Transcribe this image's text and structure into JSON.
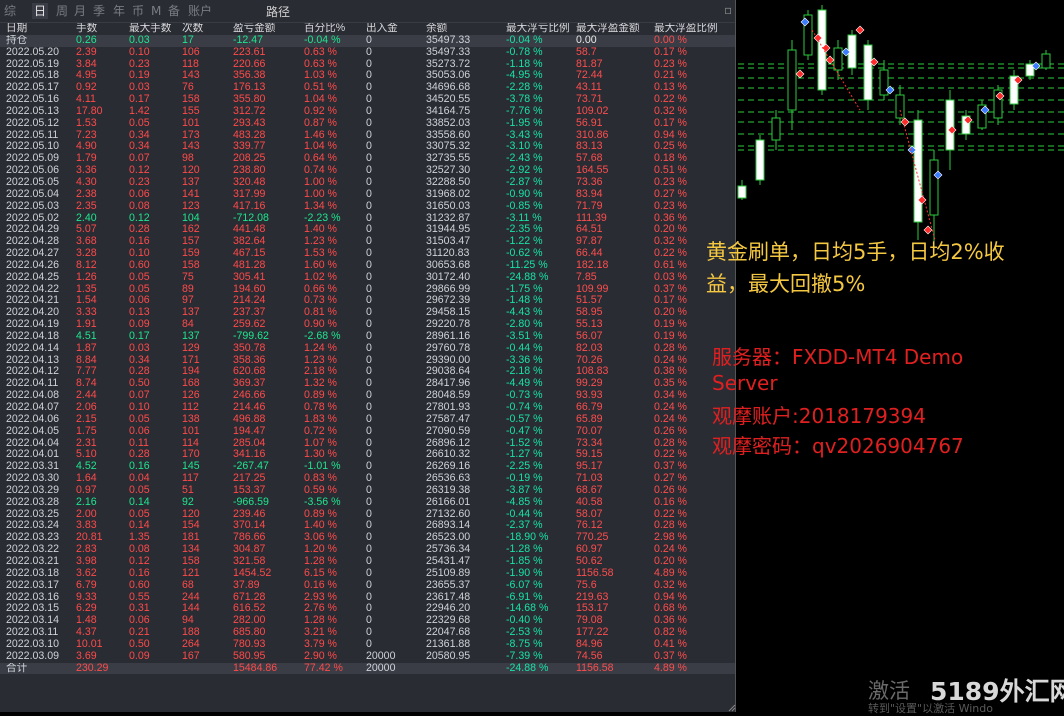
{
  "toolbar": {
    "tabs": [
      "综",
      "日",
      "周",
      "月",
      "季",
      "年",
      "币",
      "M",
      "备",
      "账户"
    ],
    "active_tab": "日",
    "right_label": "路径",
    "close_glyph": "▫"
  },
  "table": {
    "headers": [
      "日期",
      "手数",
      "最大手数",
      "次数",
      "盈亏金额",
      "百分比%",
      "出入金",
      "余额",
      "最大浮亏比例",
      "最大浮盈金额",
      "最大浮盈比例"
    ],
    "holding": {
      "label": "持仓",
      "lots": "0.26",
      "max_lots": "0.03",
      "count": "17",
      "pnl": "-12.47",
      "pct": "-0.04 %",
      "flow": "0",
      "balance": "35497.33",
      "max_dd": "-0.04 %",
      "max_fp": "0.00",
      "max_fp_pct": "0.00 %"
    },
    "rows": [
      [
        "2022.05.20",
        "2.39",
        "0.10",
        "106",
        "223.61",
        "0.63 %",
        "0",
        "35497.33",
        "-0.78 %",
        "58.7",
        "0.17 %"
      ],
      [
        "2022.05.19",
        "3.84",
        "0.23",
        "118",
        "220.66",
        "0.63 %",
        "0",
        "35273.72",
        "-1.18 %",
        "81.87",
        "0.23 %"
      ],
      [
        "2022.05.18",
        "4.95",
        "0.19",
        "143",
        "356.38",
        "1.03 %",
        "0",
        "35053.06",
        "-4.95 %",
        "72.44",
        "0.21 %"
      ],
      [
        "2022.05.17",
        "0.92",
        "0.03",
        "76",
        "176.13",
        "0.51 %",
        "0",
        "34696.68",
        "-2.28 %",
        "43.11",
        "0.13 %"
      ],
      [
        "2022.05.16",
        "4.11",
        "0.17",
        "158",
        "355.80",
        "1.04 %",
        "0",
        "34520.55",
        "-3.78 %",
        "73.71",
        "0.22 %"
      ],
      [
        "2022.05.13",
        "17.80",
        "1.42",
        "155",
        "312.72",
        "0.92 %",
        "0",
        "34164.75",
        "-7.76 %",
        "109.02",
        "0.32 %"
      ],
      [
        "2022.05.12",
        "1.53",
        "0.05",
        "101",
        "293.43",
        "0.87 %",
        "0",
        "33852.03",
        "-1.95 %",
        "56.91",
        "0.17 %"
      ],
      [
        "2022.05.11",
        "7.23",
        "0.34",
        "173",
        "483.28",
        "1.46 %",
        "0",
        "33558.60",
        "-3.43 %",
        "310.86",
        "0.94 %"
      ],
      [
        "2022.05.10",
        "4.90",
        "0.34",
        "143",
        "339.77",
        "1.04 %",
        "0",
        "33075.32",
        "-3.10 %",
        "83.13",
        "0.25 %"
      ],
      [
        "2022.05.09",
        "1.79",
        "0.07",
        "98",
        "208.25",
        "0.64 %",
        "0",
        "32735.55",
        "-2.43 %",
        "57.68",
        "0.18 %"
      ],
      [
        "2022.05.06",
        "3.36",
        "0.12",
        "120",
        "238.80",
        "0.74 %",
        "0",
        "32527.30",
        "-2.92 %",
        "164.55",
        "0.51 %"
      ],
      [
        "2022.05.05",
        "4.30",
        "0.23",
        "137",
        "320.48",
        "1.00 %",
        "0",
        "32288.50",
        "-2.87 %",
        "73.36",
        "0.23 %"
      ],
      [
        "2022.05.04",
        "2.38",
        "0.06",
        "141",
        "317.99",
        "1.00 %",
        "0",
        "31968.02",
        "-0.90 %",
        "83.94",
        "0.27 %"
      ],
      [
        "2022.05.03",
        "2.35",
        "0.08",
        "123",
        "417.16",
        "1.34 %",
        "0",
        "31650.03",
        "-0.85 %",
        "71.79",
        "0.23 %"
      ],
      [
        "2022.05.02",
        "2.40",
        "0.12",
        "104",
        "-712.08",
        "-2.23 %",
        "0",
        "31232.87",
        "-3.11 %",
        "111.39",
        "0.36 %"
      ],
      [
        "2022.04.29",
        "5.07",
        "0.28",
        "162",
        "441.48",
        "1.40 %",
        "0",
        "31944.95",
        "-2.35 %",
        "64.51",
        "0.20 %"
      ],
      [
        "2022.04.28",
        "3.68",
        "0.16",
        "157",
        "382.64",
        "1.23 %",
        "0",
        "31503.47",
        "-1.22 %",
        "97.87",
        "0.32 %"
      ],
      [
        "2022.04.27",
        "3.28",
        "0.10",
        "159",
        "467.15",
        "1.53 %",
        "0",
        "31120.83",
        "-0.62 %",
        "66.44",
        "0.22 %"
      ],
      [
        "2022.04.26",
        "8.12",
        "0.60",
        "158",
        "481.28",
        "1.60 %",
        "0",
        "30653.68",
        "-11.25 %",
        "182.18",
        "0.61 %"
      ],
      [
        "2022.04.25",
        "1.26",
        "0.05",
        "75",
        "305.41",
        "1.02 %",
        "0",
        "30172.40",
        "-24.88 %",
        "7.85",
        "0.03 %"
      ],
      [
        "2022.04.22",
        "1.35",
        "0.05",
        "89",
        "194.60",
        "0.66 %",
        "0",
        "29866.99",
        "-1.75 %",
        "109.99",
        "0.37 %"
      ],
      [
        "2022.04.21",
        "1.54",
        "0.06",
        "97",
        "214.24",
        "0.73 %",
        "0",
        "29672.39",
        "-1.48 %",
        "51.57",
        "0.17 %"
      ],
      [
        "2022.04.20",
        "3.33",
        "0.13",
        "137",
        "237.37",
        "0.81 %",
        "0",
        "29458.15",
        "-4.43 %",
        "58.95",
        "0.20 %"
      ],
      [
        "2022.04.19",
        "1.91",
        "0.09",
        "84",
        "259.62",
        "0.90 %",
        "0",
        "29220.78",
        "-2.80 %",
        "55.13",
        "0.19 %"
      ],
      [
        "2022.04.18",
        "4.51",
        "0.17",
        "137",
        "-799.62",
        "-2.68 %",
        "0",
        "28961.16",
        "-3.51 %",
        "56.07",
        "0.19 %"
      ],
      [
        "2022.04.14",
        "1.87",
        "0.03",
        "129",
        "350.78",
        "1.24 %",
        "0",
        "29760.78",
        "-0.44 %",
        "82.03",
        "0.28 %"
      ],
      [
        "2022.04.13",
        "8.84",
        "0.34",
        "171",
        "358.36",
        "1.23 %",
        "0",
        "29390.00",
        "-3.36 %",
        "70.26",
        "0.24 %"
      ],
      [
        "2022.04.12",
        "7.77",
        "0.28",
        "194",
        "620.68",
        "2.18 %",
        "0",
        "29038.64",
        "-2.18 %",
        "108.83",
        "0.38 %"
      ],
      [
        "2022.04.11",
        "8.74",
        "0.50",
        "168",
        "369.37",
        "1.32 %",
        "0",
        "28417.96",
        "-4.49 %",
        "99.29",
        "0.35 %"
      ],
      [
        "2022.04.08",
        "2.44",
        "0.07",
        "126",
        "246.66",
        "0.89 %",
        "0",
        "28048.59",
        "-0.73 %",
        "93.93",
        "0.34 %"
      ],
      [
        "2022.04.07",
        "2.06",
        "0.10",
        "112",
        "214.46",
        "0.78 %",
        "0",
        "27801.93",
        "-0.74 %",
        "66.79",
        "0.24 %"
      ],
      [
        "2022.04.06",
        "2.15",
        "0.05",
        "138",
        "496.88",
        "1.83 %",
        "0",
        "27587.47",
        "-0.57 %",
        "65.89",
        "0.24 %"
      ],
      [
        "2022.04.05",
        "1.75",
        "0.06",
        "101",
        "194.47",
        "0.72 %",
        "0",
        "27090.59",
        "-0.47 %",
        "70.07",
        "0.26 %"
      ],
      [
        "2022.04.04",
        "2.31",
        "0.11",
        "114",
        "285.04",
        "1.07 %",
        "0",
        "26896.12",
        "-1.52 %",
        "73.34",
        "0.28 %"
      ],
      [
        "2022.04.01",
        "5.10",
        "0.28",
        "170",
        "341.16",
        "1.30 %",
        "0",
        "26610.32",
        "-1.27 %",
        "59.15",
        "0.22 %"
      ],
      [
        "2022.03.31",
        "4.52",
        "0.16",
        "145",
        "-267.47",
        "-1.01 %",
        "0",
        "26269.16",
        "-2.25 %",
        "95.17",
        "0.37 %"
      ],
      [
        "2022.03.30",
        "1.64",
        "0.04",
        "117",
        "217.25",
        "0.83 %",
        "0",
        "26536.63",
        "-0.19 %",
        "71.03",
        "0.27 %"
      ],
      [
        "2022.03.29",
        "0.97",
        "0.05",
        "51",
        "153.37",
        "0.59 %",
        "0",
        "26319.38",
        "-3.87 %",
        "68.67",
        "0.26 %"
      ],
      [
        "2022.03.28",
        "2.16",
        "0.14",
        "92",
        "-966.59",
        "-3.56 %",
        "0",
        "26166.01",
        "-4.85 %",
        "40.58",
        "0.16 %"
      ],
      [
        "2022.03.25",
        "2.00",
        "0.05",
        "120",
        "239.46",
        "0.89 %",
        "0",
        "27132.60",
        "-0.44 %",
        "58.07",
        "0.22 %"
      ],
      [
        "2022.03.24",
        "3.83",
        "0.14",
        "154",
        "370.14",
        "1.40 %",
        "0",
        "26893.14",
        "-2.37 %",
        "76.12",
        "0.28 %"
      ],
      [
        "2022.03.23",
        "20.81",
        "1.35",
        "181",
        "786.66",
        "3.06 %",
        "0",
        "26523.00",
        "-18.90 %",
        "770.25",
        "2.98 %"
      ],
      [
        "2022.03.22",
        "2.83",
        "0.08",
        "134",
        "304.87",
        "1.20 %",
        "0",
        "25736.34",
        "-1.28 %",
        "60.97",
        "0.24 %"
      ],
      [
        "2022.03.21",
        "3.98",
        "0.12",
        "158",
        "321.58",
        "1.28 %",
        "0",
        "25431.47",
        "-1.85 %",
        "50.62",
        "0.20 %"
      ],
      [
        "2022.03.18",
        "3.62",
        "0.16",
        "121",
        "1454.52",
        "6.15 %",
        "0",
        "25109.89",
        "-1.90 %",
        "1156.58",
        "4.89 %"
      ],
      [
        "2022.03.17",
        "6.79",
        "0.60",
        "68",
        "37.89",
        "0.16 %",
        "0",
        "23655.37",
        "-6.07 %",
        "75.6",
        "0.32 %"
      ],
      [
        "2022.03.16",
        "9.33",
        "0.55",
        "244",
        "671.28",
        "2.93 %",
        "0",
        "23617.48",
        "-6.91 %",
        "219.63",
        "0.94 %"
      ],
      [
        "2022.03.15",
        "6.29",
        "0.31",
        "144",
        "616.52",
        "2.76 %",
        "0",
        "22946.20",
        "-14.68 %",
        "153.17",
        "0.68 %"
      ],
      [
        "2022.03.14",
        "1.48",
        "0.06",
        "94",
        "282.00",
        "1.28 %",
        "0",
        "22329.68",
        "-0.40 %",
        "79.08",
        "0.36 %"
      ],
      [
        "2022.03.11",
        "4.37",
        "0.21",
        "188",
        "685.80",
        "3.21 %",
        "0",
        "22047.68",
        "-2.53 %",
        "177.22",
        "0.82 %"
      ],
      [
        "2022.03.10",
        "10.01",
        "0.50",
        "264",
        "780.93",
        "3.79 %",
        "0",
        "21361.88",
        "-8.75 %",
        "84.96",
        "0.41 %"
      ],
      [
        "2022.03.09",
        "3.69",
        "0.09",
        "167",
        "580.95",
        "2.90 %",
        "20000",
        "20580.95",
        "-7.39 %",
        "74.56",
        "0.37 %"
      ]
    ],
    "total": {
      "label": "合计",
      "lots": "230.29",
      "max_lots": "",
      "count": "",
      "pnl": "15484.86",
      "pct": "77.42 %",
      "flow": "20000",
      "balance": "",
      "max_dd": "-24.88 %",
      "max_fp": "1156.58",
      "max_fp_pct": "4.89 %"
    }
  },
  "overlay": {
    "promo_line1": "黄金刷单，日均5手，日均2%收",
    "promo_line2": "益，最大回撤5%",
    "server_line1": "服务器：FXDD-MT4 Demo",
    "server_line2": "Server",
    "account": "观摩账户:2018179394",
    "password": "观摩密码：qv2026904767",
    "activate_text": "激活",
    "watermark": "5189外汇网",
    "activate_sub": "转到\"设置\"以激活 Windo"
  },
  "colors": {
    "panel_bg": "#2a2c33",
    "positive": "#ff4a4a",
    "negative": "#1ee58f",
    "drawdown": "#17e3a6",
    "promo": "#f5c842",
    "server": "#e02020"
  }
}
